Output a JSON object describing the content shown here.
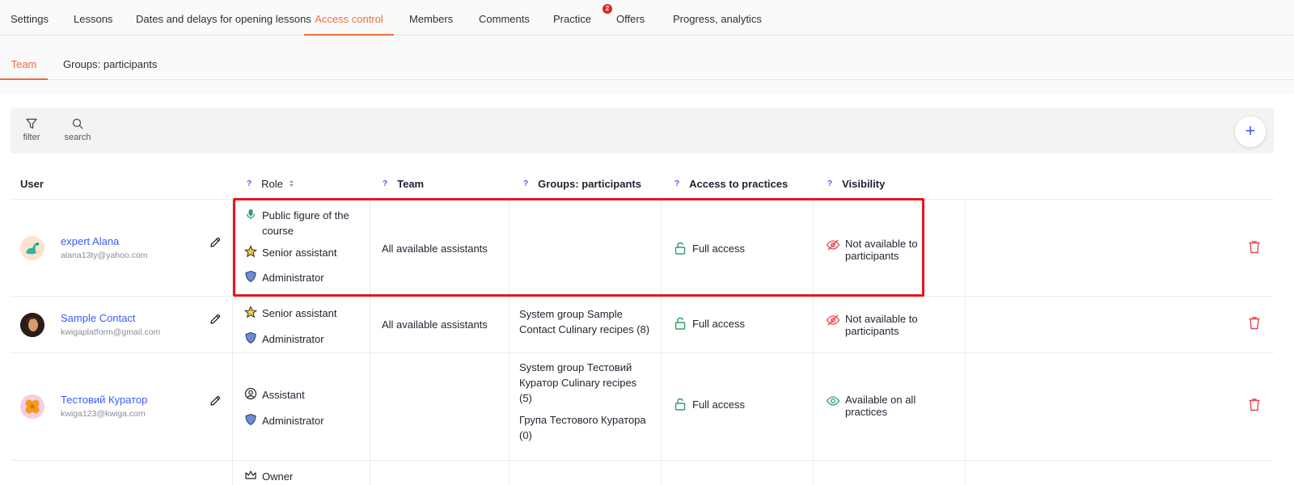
{
  "top_tabs": [
    {
      "label": "Settings"
    },
    {
      "label": "Lessons"
    },
    {
      "label": "Dates and delays for opening lessons"
    },
    {
      "label": "Access control",
      "active": true
    },
    {
      "label": "Members"
    },
    {
      "label": "Comments"
    },
    {
      "label": "Practice",
      "badge": "2"
    },
    {
      "label": "Offers"
    },
    {
      "label": "Progress, analytics"
    }
  ],
  "sub_tabs": [
    {
      "label": "Team",
      "active": true
    },
    {
      "label": "Groups: participants"
    }
  ],
  "toolbar": {
    "filter_label": "filter",
    "search_label": "search",
    "add_label": "+"
  },
  "table": {
    "headers": {
      "user": "User",
      "help_mark": "?",
      "role": "Role",
      "team": "Team",
      "groups": "Groups: participants",
      "access": "Access to practices",
      "visibility": "Visibility"
    },
    "rows": [
      {
        "name": "expert Alana",
        "email": "alana13ty@yahoo.com",
        "avatar": "dinosaur-avatar",
        "roles": [
          {
            "icon": "microphone-icon",
            "label": "Public figure of the course"
          },
          {
            "icon": "star-icon",
            "label": "Senior assistant"
          },
          {
            "icon": "shield-icon",
            "label": "Administrator"
          }
        ],
        "team": "All available assistants",
        "groups": [],
        "access": "Full access",
        "visibility": "Not available to participants"
      },
      {
        "name": "Sample Contact",
        "email": "kwigaplatform@gmail.com",
        "avatar": "photo-avatar",
        "roles": [
          {
            "icon": "star-icon",
            "label": "Senior assistant"
          },
          {
            "icon": "shield-icon",
            "label": "Administrator"
          }
        ],
        "team": "All available assistants",
        "groups": [
          "System group Sample Contact Culinary recipes (8)"
        ],
        "access": "Full access",
        "visibility": "Not available to participants"
      },
      {
        "name": "Тестовий Куратор",
        "email": "kwiga123@kwiga.com",
        "avatar": "flower-avatar",
        "roles": [
          {
            "icon": "user-circle-icon",
            "label": "Assistant"
          },
          {
            "icon": "shield-icon",
            "label": "Administrator"
          }
        ],
        "team": "",
        "groups": [
          "System group Тестовий Куратор Culinary recipes (5)",
          "Група Тестового Куратора (0)"
        ],
        "access": "Full access",
        "visibility": "Available on all practices"
      },
      {
        "roles": [
          {
            "icon": "crown-icon",
            "label": "Owner"
          }
        ]
      }
    ]
  },
  "colors": {
    "accent": "#f26b3a",
    "link": "#3d5afe",
    "success": "#2e9e6b",
    "danger": "#e5484d",
    "highlight": "#e8161d"
  }
}
